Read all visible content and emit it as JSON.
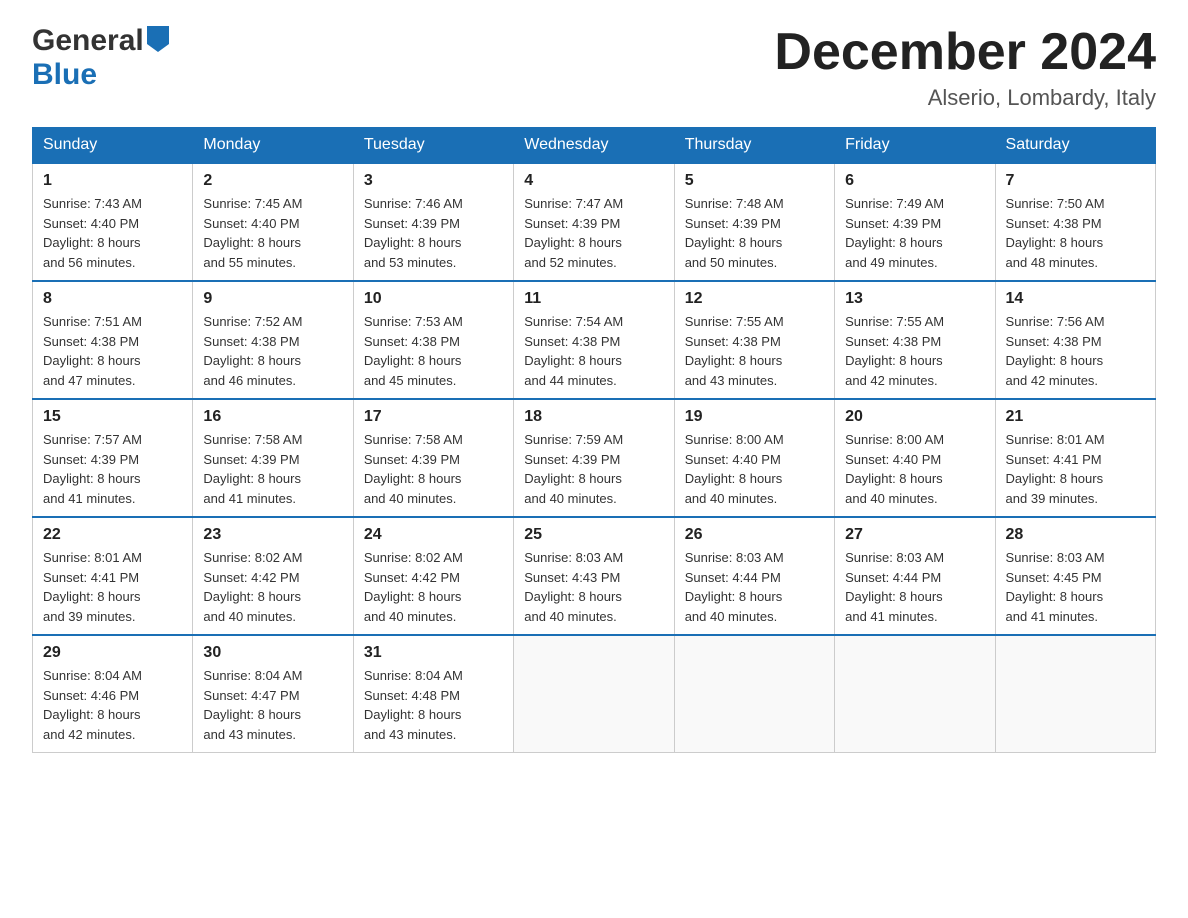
{
  "header": {
    "logo_general": "General",
    "logo_blue": "Blue",
    "title": "December 2024",
    "location": "Alserio, Lombardy, Italy"
  },
  "days_of_week": [
    "Sunday",
    "Monday",
    "Tuesday",
    "Wednesday",
    "Thursday",
    "Friday",
    "Saturday"
  ],
  "weeks": [
    [
      {
        "day": "1",
        "sunrise": "7:43 AM",
        "sunset": "4:40 PM",
        "daylight": "8 hours and 56 minutes."
      },
      {
        "day": "2",
        "sunrise": "7:45 AM",
        "sunset": "4:40 PM",
        "daylight": "8 hours and 55 minutes."
      },
      {
        "day": "3",
        "sunrise": "7:46 AM",
        "sunset": "4:39 PM",
        "daylight": "8 hours and 53 minutes."
      },
      {
        "day": "4",
        "sunrise": "7:47 AM",
        "sunset": "4:39 PM",
        "daylight": "8 hours and 52 minutes."
      },
      {
        "day": "5",
        "sunrise": "7:48 AM",
        "sunset": "4:39 PM",
        "daylight": "8 hours and 50 minutes."
      },
      {
        "day": "6",
        "sunrise": "7:49 AM",
        "sunset": "4:39 PM",
        "daylight": "8 hours and 49 minutes."
      },
      {
        "day": "7",
        "sunrise": "7:50 AM",
        "sunset": "4:38 PM",
        "daylight": "8 hours and 48 minutes."
      }
    ],
    [
      {
        "day": "8",
        "sunrise": "7:51 AM",
        "sunset": "4:38 PM",
        "daylight": "8 hours and 47 minutes."
      },
      {
        "day": "9",
        "sunrise": "7:52 AM",
        "sunset": "4:38 PM",
        "daylight": "8 hours and 46 minutes."
      },
      {
        "day": "10",
        "sunrise": "7:53 AM",
        "sunset": "4:38 PM",
        "daylight": "8 hours and 45 minutes."
      },
      {
        "day": "11",
        "sunrise": "7:54 AM",
        "sunset": "4:38 PM",
        "daylight": "8 hours and 44 minutes."
      },
      {
        "day": "12",
        "sunrise": "7:55 AM",
        "sunset": "4:38 PM",
        "daylight": "8 hours and 43 minutes."
      },
      {
        "day": "13",
        "sunrise": "7:55 AM",
        "sunset": "4:38 PM",
        "daylight": "8 hours and 42 minutes."
      },
      {
        "day": "14",
        "sunrise": "7:56 AM",
        "sunset": "4:38 PM",
        "daylight": "8 hours and 42 minutes."
      }
    ],
    [
      {
        "day": "15",
        "sunrise": "7:57 AM",
        "sunset": "4:39 PM",
        "daylight": "8 hours and 41 minutes."
      },
      {
        "day": "16",
        "sunrise": "7:58 AM",
        "sunset": "4:39 PM",
        "daylight": "8 hours and 41 minutes."
      },
      {
        "day": "17",
        "sunrise": "7:58 AM",
        "sunset": "4:39 PM",
        "daylight": "8 hours and 40 minutes."
      },
      {
        "day": "18",
        "sunrise": "7:59 AM",
        "sunset": "4:39 PM",
        "daylight": "8 hours and 40 minutes."
      },
      {
        "day": "19",
        "sunrise": "8:00 AM",
        "sunset": "4:40 PM",
        "daylight": "8 hours and 40 minutes."
      },
      {
        "day": "20",
        "sunrise": "8:00 AM",
        "sunset": "4:40 PM",
        "daylight": "8 hours and 40 minutes."
      },
      {
        "day": "21",
        "sunrise": "8:01 AM",
        "sunset": "4:41 PM",
        "daylight": "8 hours and 39 minutes."
      }
    ],
    [
      {
        "day": "22",
        "sunrise": "8:01 AM",
        "sunset": "4:41 PM",
        "daylight": "8 hours and 39 minutes."
      },
      {
        "day": "23",
        "sunrise": "8:02 AM",
        "sunset": "4:42 PM",
        "daylight": "8 hours and 40 minutes."
      },
      {
        "day": "24",
        "sunrise": "8:02 AM",
        "sunset": "4:42 PM",
        "daylight": "8 hours and 40 minutes."
      },
      {
        "day": "25",
        "sunrise": "8:03 AM",
        "sunset": "4:43 PM",
        "daylight": "8 hours and 40 minutes."
      },
      {
        "day": "26",
        "sunrise": "8:03 AM",
        "sunset": "4:44 PM",
        "daylight": "8 hours and 40 minutes."
      },
      {
        "day": "27",
        "sunrise": "8:03 AM",
        "sunset": "4:44 PM",
        "daylight": "8 hours and 41 minutes."
      },
      {
        "day": "28",
        "sunrise": "8:03 AM",
        "sunset": "4:45 PM",
        "daylight": "8 hours and 41 minutes."
      }
    ],
    [
      {
        "day": "29",
        "sunrise": "8:04 AM",
        "sunset": "4:46 PM",
        "daylight": "8 hours and 42 minutes."
      },
      {
        "day": "30",
        "sunrise": "8:04 AM",
        "sunset": "4:47 PM",
        "daylight": "8 hours and 43 minutes."
      },
      {
        "day": "31",
        "sunrise": "8:04 AM",
        "sunset": "4:48 PM",
        "daylight": "8 hours and 43 minutes."
      },
      null,
      null,
      null,
      null
    ]
  ],
  "labels": {
    "sunrise": "Sunrise:",
    "sunset": "Sunset:",
    "daylight": "Daylight:"
  }
}
